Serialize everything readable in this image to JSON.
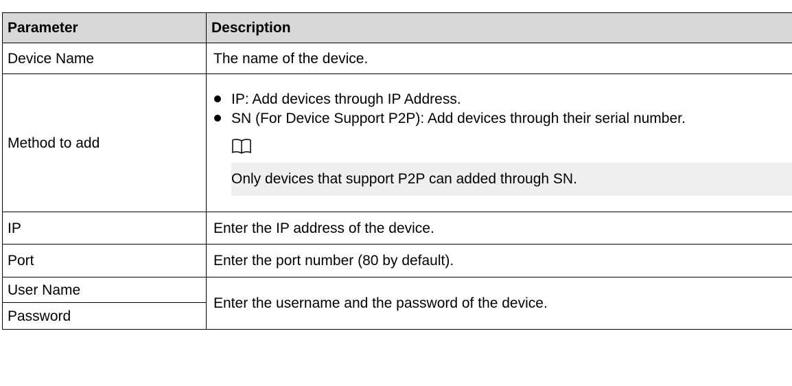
{
  "table": {
    "headers": {
      "parameter": "Parameter",
      "description": "Description"
    },
    "rows": {
      "device_name": {
        "parameter": "Device Name",
        "description": "The name of the device."
      },
      "method": {
        "parameter": "Method to add",
        "bullets": [
          "IP: Add devices through IP Address.",
          "SN (For Device Support P2P): Add devices through their serial number."
        ],
        "note_icon": "book-icon",
        "note": "Only devices that support P2P can added through SN."
      },
      "ip": {
        "parameter": "IP",
        "description": "Enter the IP address of the device."
      },
      "port": {
        "parameter": "Port",
        "description": "Enter the port number (80 by default)."
      },
      "user_name": {
        "parameter": "User Name"
      },
      "password": {
        "parameter": "Password"
      },
      "credentials_description": "Enter the username and the password of the device."
    }
  },
  "colors": {
    "header_background": "#d8d8d8",
    "note_background": "#efefef",
    "border": "#000000"
  }
}
